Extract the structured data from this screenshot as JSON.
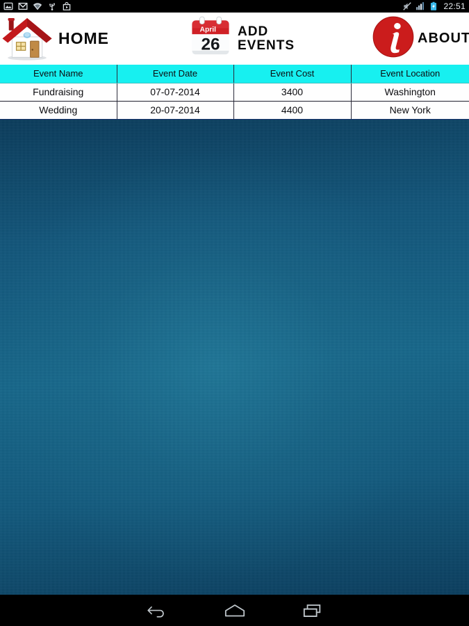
{
  "status_bar": {
    "icons": [
      {
        "name": "gallery-icon",
        "label": "Gallery"
      },
      {
        "name": "gmail-icon",
        "label": "Gmail"
      },
      {
        "name": "wifi-icon",
        "label": "Wi-Fi"
      },
      {
        "name": "usb-icon",
        "label": "USB"
      },
      {
        "name": "play-store-icon",
        "label": "Play Store"
      }
    ],
    "right_icons": [
      {
        "name": "mute-icon",
        "label": "Silent"
      },
      {
        "name": "signal-icon",
        "label": "Signal"
      },
      {
        "name": "battery-charging-icon",
        "label": "Charging"
      }
    ],
    "clock": "22:51"
  },
  "header": {
    "home": {
      "label": "HOME",
      "icon": "house-icon"
    },
    "add_events": {
      "line1": "ADD",
      "line2": "EVENTS",
      "icon": "calendar-icon",
      "calendar_month": "April",
      "calendar_day": "26"
    },
    "about": {
      "label": "ABOUT",
      "icon": "info-circle-icon"
    }
  },
  "table": {
    "columns": [
      "Event Name",
      "Event Date",
      "Event Cost",
      "Event Location"
    ],
    "rows": [
      [
        "Fundraising",
        "07-07-2014",
        "3400",
        "Washington"
      ],
      [
        "Wedding",
        "20-07-2014",
        "4400",
        "New York"
      ]
    ]
  },
  "nav_bar": {
    "back": "Back",
    "home": "Home",
    "recents": "Recent apps"
  },
  "colors": {
    "header_background": "#ffffff",
    "table_header": "#17f0f0",
    "table_row": "#fefefe",
    "accent_red": "#c0191b",
    "wallpaper_center": "#18678a",
    "wallpaper_edge": "#0d3d5c",
    "status_bar": "#000000"
  }
}
